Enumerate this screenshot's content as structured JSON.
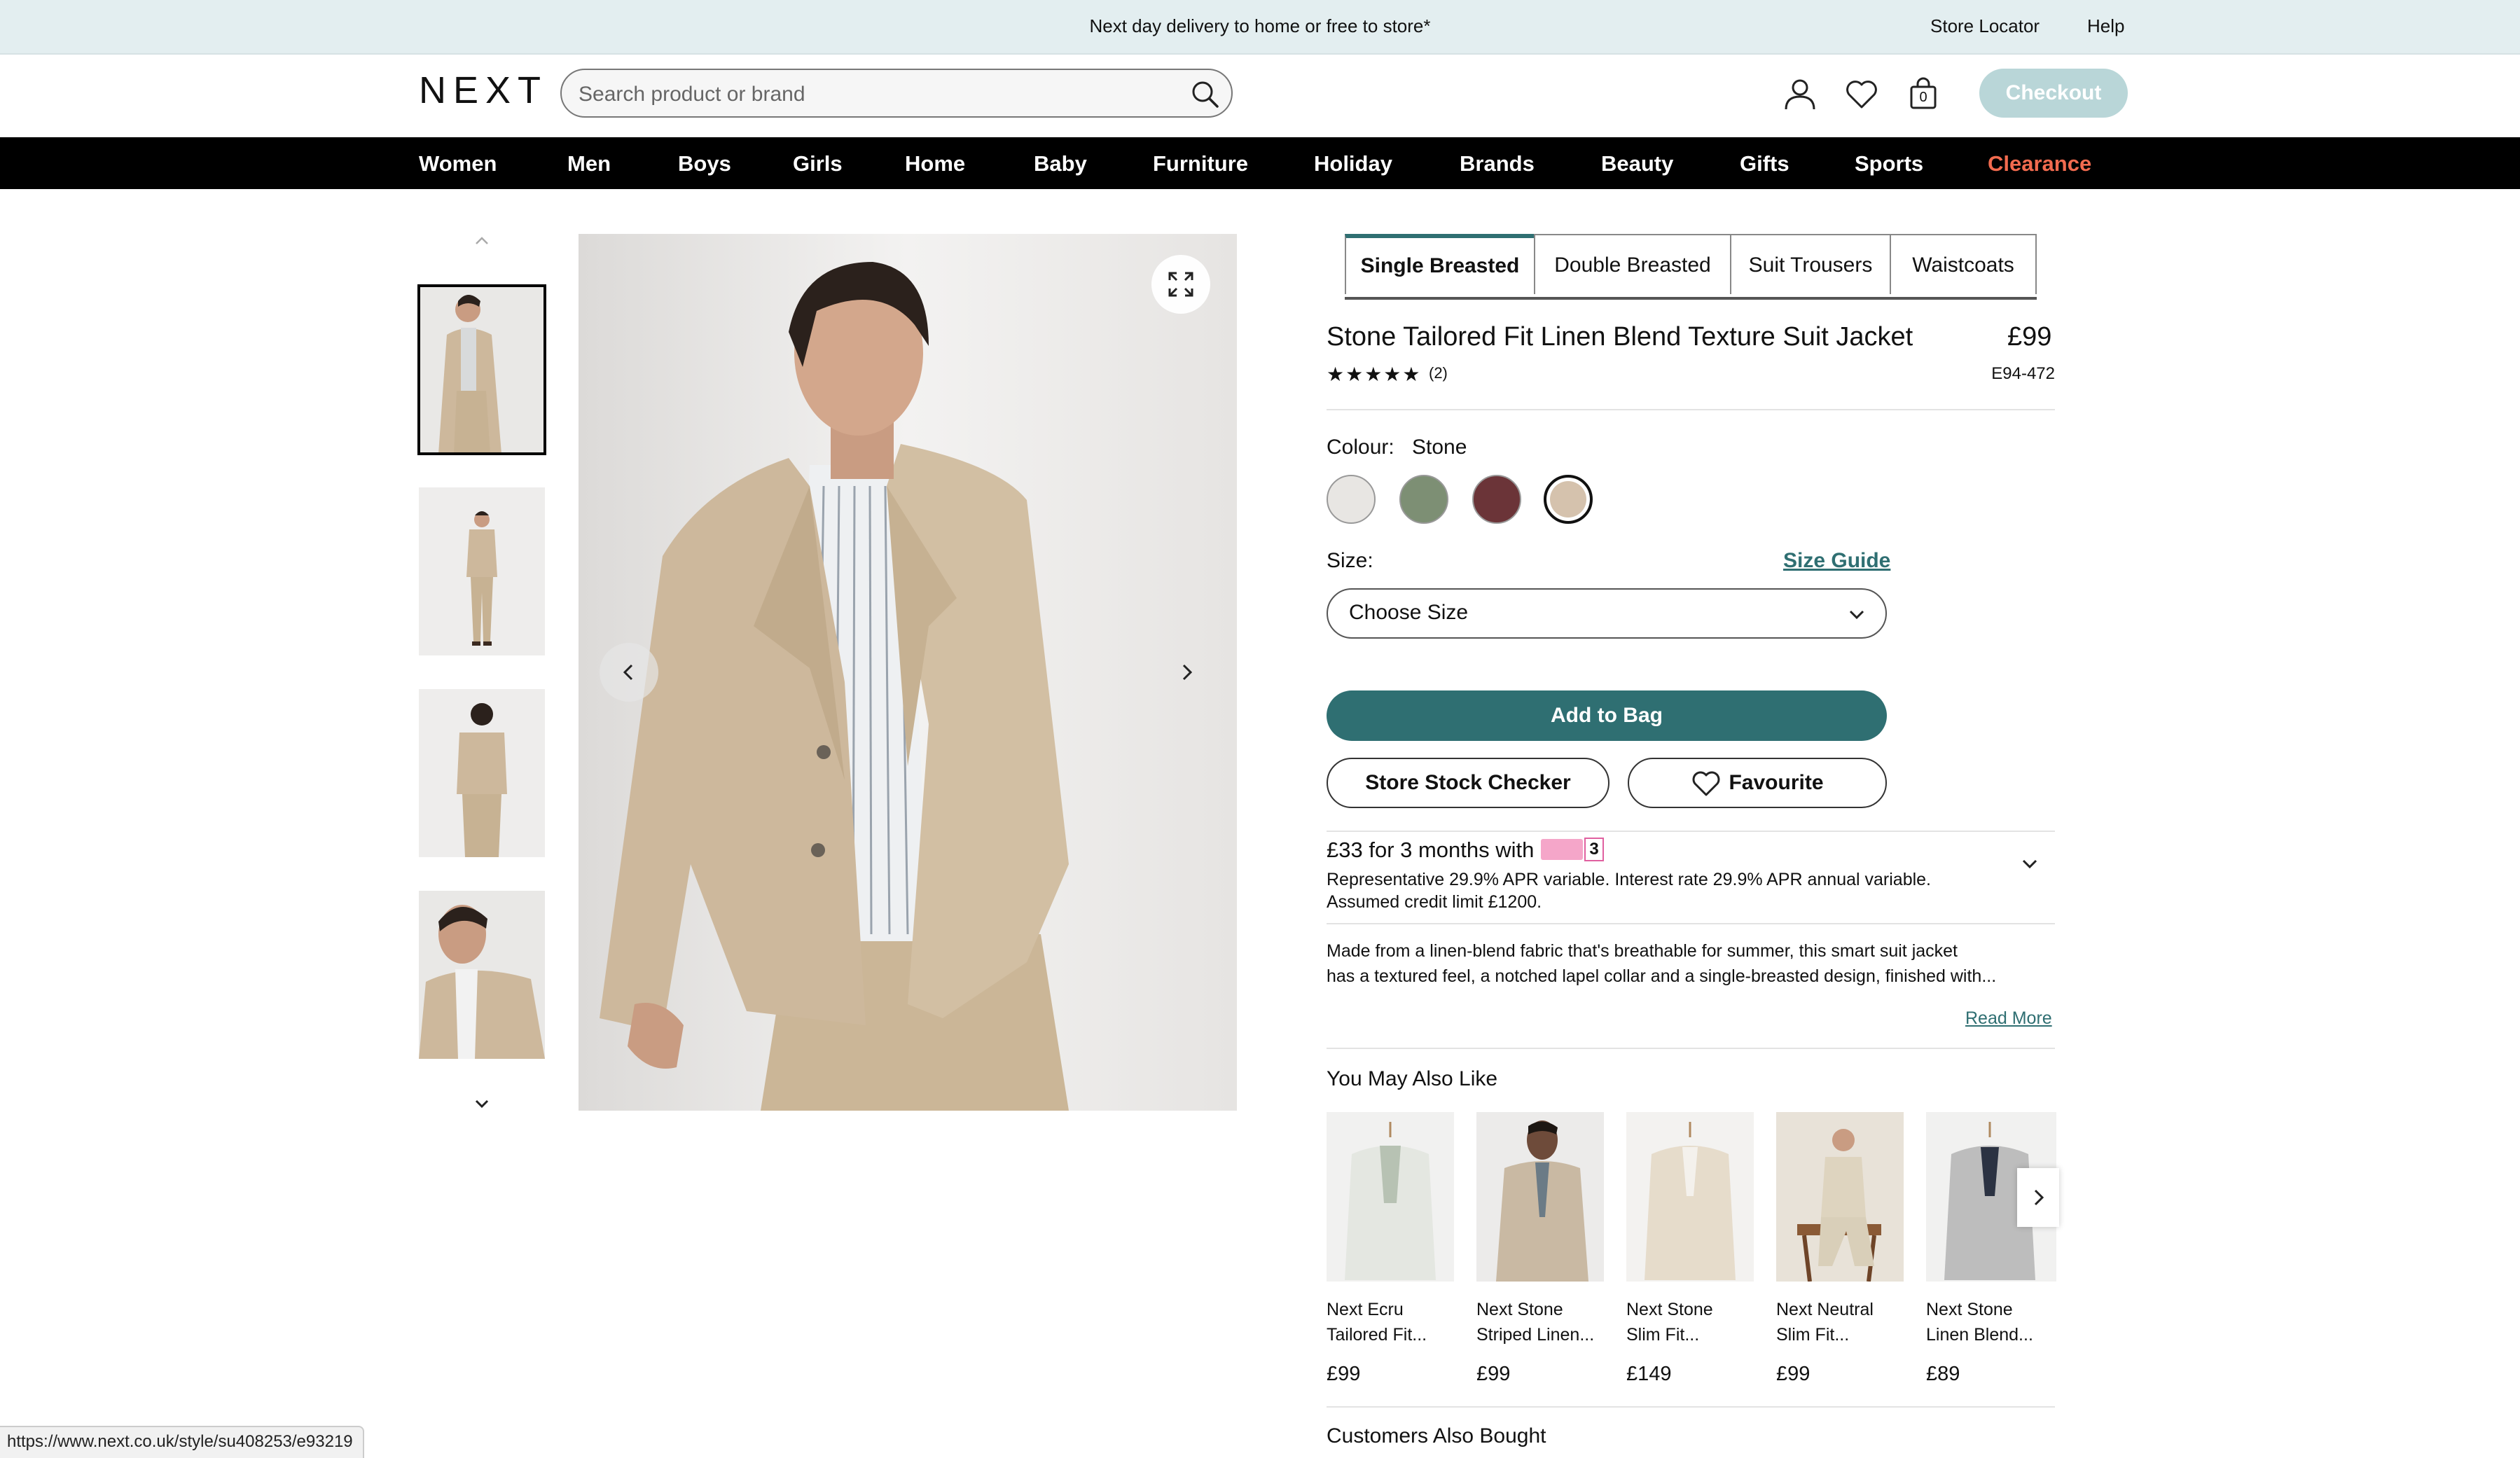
{
  "banner": {
    "message": "Next day delivery to home or free to store*",
    "store_locator": "Store Locator",
    "help": "Help"
  },
  "header": {
    "logo": "NEXT",
    "search_placeholder": "Search product or brand",
    "bag_count": "0",
    "checkout": "Checkout"
  },
  "nav": {
    "items": [
      "Women",
      "Men",
      "Boys",
      "Girls",
      "Home",
      "Baby",
      "Furniture",
      "Holiday",
      "Brands",
      "Beauty",
      "Gifts",
      "Sports",
      "Clearance"
    ],
    "clearance_color": "#f26b4f"
  },
  "product": {
    "tabs": [
      "Single Breasted",
      "Double Breasted",
      "Suit Trousers",
      "Waistcoats"
    ],
    "active_tab": "Single Breasted",
    "title": "Stone Tailored Fit Linen Blend Texture Suit Jacket",
    "price": "£99",
    "code": "E94-472",
    "rating": 5,
    "review_count": "(2)",
    "colour_label": "Colour:",
    "colour_value": "Stone",
    "swatches": [
      "#e8e6e3",
      "#7d8f74",
      "#6b3438",
      "#d5c2ad"
    ],
    "size_label": "Size:",
    "size_guide": "Size Guide",
    "size_select": "Choose Size",
    "add_to_bag": "Add to Bag",
    "store_stock": "Store Stock Checker",
    "favourite": "Favourite",
    "payin_title": "£33 for 3 months with",
    "payin_badge": "3",
    "payin_text_1": "Representative 29.9% APR variable. Interest rate 29.9% APR annual variable.",
    "payin_text_2": "Assumed credit limit £1200.",
    "description_1": "Made from a linen-blend fabric that's breathable for summer, this smart suit jacket",
    "description_2": "has a textured feel, a notched lapel collar and a single-breasted design, finished with...",
    "read_more": "Read More"
  },
  "recommendations": {
    "title": "You May Also Like",
    "items": [
      {
        "name1": "Next Ecru",
        "name2": "Tailored Fit...",
        "price": "£99"
      },
      {
        "name1": "Next Stone",
        "name2": "Striped Linen...",
        "price": "£99"
      },
      {
        "name1": "Next Stone",
        "name2": "Slim Fit...",
        "price": "£149"
      },
      {
        "name1": "Next Neutral",
        "name2": "Slim Fit...",
        "price": "£99"
      },
      {
        "name1": "Next Stone",
        "name2": "Linen Blend...",
        "price": "£89"
      }
    ]
  },
  "customers_also_bought": "Customers Also Bought",
  "status_url": "https://www.next.co.uk/style/su408253/e93219",
  "colors": {
    "accent": "#2f6f72",
    "banner": "#e3eef0",
    "nav": "#000000"
  }
}
